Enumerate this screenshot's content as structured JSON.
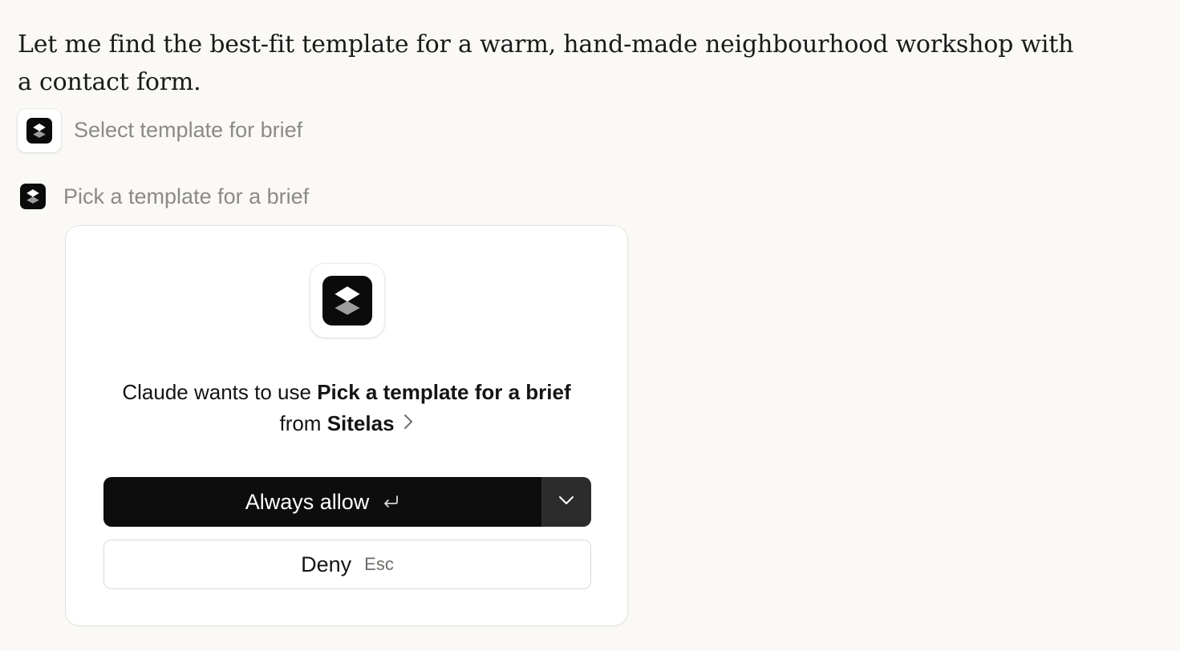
{
  "chat": {
    "message": "Let me find the best-fit template for a warm, hand-made neighbourhood workshop with a contact form.",
    "tool_call": {
      "label": "Select template for brief"
    },
    "tool_request": {
      "label": "Pick a template for a brief"
    }
  },
  "permission_card": {
    "prompt": {
      "actor": "Claude",
      "text_before": "wants to use",
      "tool_name": "Pick a template for a brief",
      "text_mid": "from",
      "source": "Sitelas"
    },
    "allow_button": {
      "label": "Always allow",
      "shortcut_icon": "return-key-icon"
    },
    "allow_menu": {
      "icon": "chevron-down-icon"
    },
    "deny_button": {
      "label": "Deny",
      "shortcut": "Esc"
    }
  },
  "colors": {
    "page_background": "#faf9f6",
    "card_background": "#ffffff",
    "primary_button": "#0d0d0d",
    "menu_button": "#2c2c2c",
    "muted_text": "#8c8a85"
  }
}
